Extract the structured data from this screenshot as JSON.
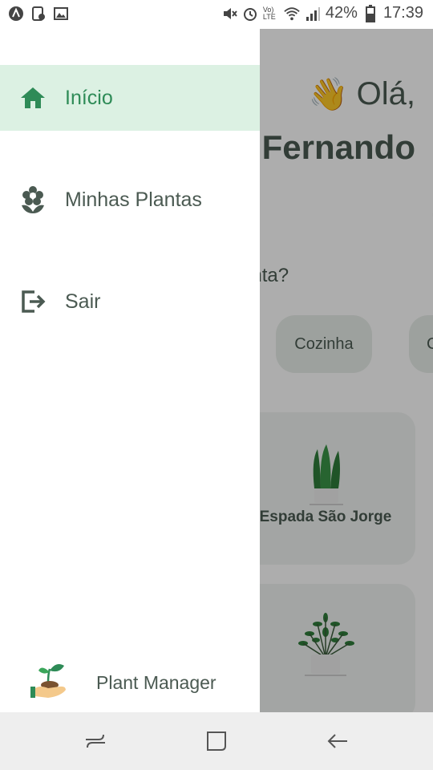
{
  "status_bar": {
    "battery": "42%",
    "time": "17:39",
    "volte_label": "Vo) LTE"
  },
  "home": {
    "greeting": "Olá,",
    "greeting_emoji": "👋",
    "user_name": "Fernando",
    "question": "anta?",
    "environments": [
      "Cozinha",
      "C"
    ],
    "plants": [
      {
        "name": "Espada São Jorge"
      },
      {
        "name": ""
      }
    ]
  },
  "drawer": {
    "items": [
      {
        "label": "Início",
        "icon": "home-icon",
        "active": true
      },
      {
        "label": "Minhas Plantas",
        "icon": "flower-icon",
        "active": false
      },
      {
        "label": "Sair",
        "icon": "logout-icon",
        "active": false
      }
    ],
    "footer": {
      "label": "Plant Manager",
      "icon": "plant-hand-logo"
    }
  },
  "colors": {
    "accent": "#2e8b57",
    "active_bg": "#dcf1e3",
    "text": "#4b5a52",
    "nav_bg": "#eeeeee"
  },
  "nav_bar": {
    "buttons": [
      "recents-icon",
      "home-square-icon",
      "back-icon"
    ]
  }
}
